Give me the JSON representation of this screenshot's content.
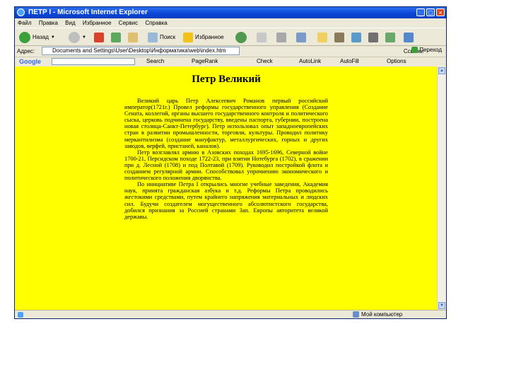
{
  "window": {
    "title": "ПЕТР I - Microsoft Internet Explorer",
    "controls": {
      "minimize": "_",
      "maximize": "□",
      "close": "×"
    }
  },
  "menu": [
    "Файл",
    "Правка",
    "Вид",
    "Избранное",
    "Сервис",
    "Справка"
  ],
  "toolbar": {
    "back": "Назад",
    "search": "Поиск",
    "favorites": "Избранное"
  },
  "address": {
    "label": "Адрес:",
    "value": "Documents and Settings\\User\\Desktop\\Информатика\\web\\index.htm",
    "go": "Переход",
    "links": "Ссылки"
  },
  "google_bar": {
    "logo": "Google",
    "search": "Search",
    "pagerank": "PageRank",
    "check": "Check",
    "autolink": "AutoLink",
    "autofill": "AutoFill",
    "options": "Options"
  },
  "document": {
    "heading": "Петр Великий",
    "paragraphs": [
      "Великий царь Петр Алексеевич Романов первый российский император(1721г.) Провел реформы государственного управления (Создание Сената, коллегий, органы высшего государственного контроля и политического сыска, церковь подчинена государству, введены паспорта, губернии, построена новая столица-Санкт-Петербург). Петр использовал опыт западноевропейских стран в развитии промышленности, торговли, культуры. Проводил политику меркантилизма (создание мануфактур, металлургических, горных и других заводов, верфей, пристаней, каналов).",
      "Петр возглавлял армию в Азовских походах 1695-1696, Северной войне 1700-21, Персидском походе 1722-23, при взятии Нотебурга (1702), в сражении при д. Лесной (1708) и под Полтавой (1709). Руководил постройкой флота и созданием регулярной армии. Способствовал упрочнению экономического и политического положения дворянства.",
      "По инициативе Петра I открылись многие учебные заведения, Академия наук, принята гражданская азбука и т.д. Реформы Петра проводились жестокими средствами, путем крайнего напряжения материальных и людских сил. Будучи создателем могущественного абсолютистского государства, добился признания за Россией странами Зап. Европы авторитета великой державы."
    ]
  },
  "status": {
    "zone": "Мой компьютер"
  }
}
